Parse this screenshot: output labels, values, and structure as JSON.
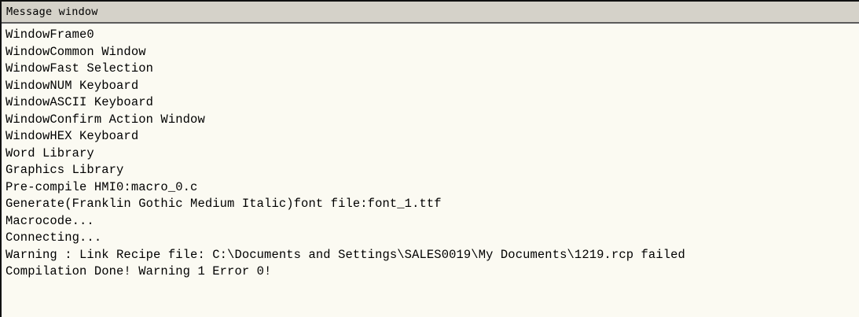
{
  "window": {
    "title": "Message window"
  },
  "messages": [
    "WindowFrame0",
    "WindowCommon Window",
    "WindowFast Selection",
    "WindowNUM Keyboard",
    "WindowASCII Keyboard",
    "WindowConfirm Action Window",
    "WindowHEX Keyboard",
    "Word Library",
    "Graphics Library",
    "Pre-compile HMI0:macro_0.c",
    "Generate(Franklin Gothic Medium Italic)font file:font_1.ttf",
    "Macrocode...",
    "Connecting...",
    "Warning : Link Recipe file: C:\\Documents and Settings\\SALES0019\\My Documents\\1219.rcp failed",
    "Compilation Done! Warning 1 Error 0!"
  ]
}
